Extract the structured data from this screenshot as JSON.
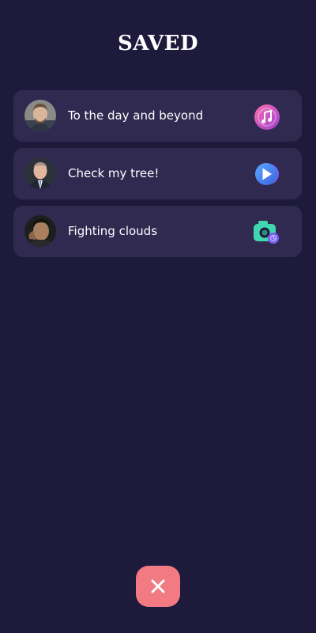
{
  "header": {
    "title": "SAVED"
  },
  "items": [
    {
      "label": "To the day and beyond",
      "avatar": "person-avatar",
      "icon": "music-icon"
    },
    {
      "label": "Check my tree!",
      "avatar": "person-avatar",
      "icon": "play-icon"
    },
    {
      "label": "Fighting clouds",
      "avatar": "person-avatar",
      "icon": "camera-icon"
    }
  ],
  "footer": {
    "close_icon": "close-icon"
  },
  "colors": {
    "background": "#1e1a3b",
    "card": "#302a51",
    "close_button": "#f27a82"
  }
}
